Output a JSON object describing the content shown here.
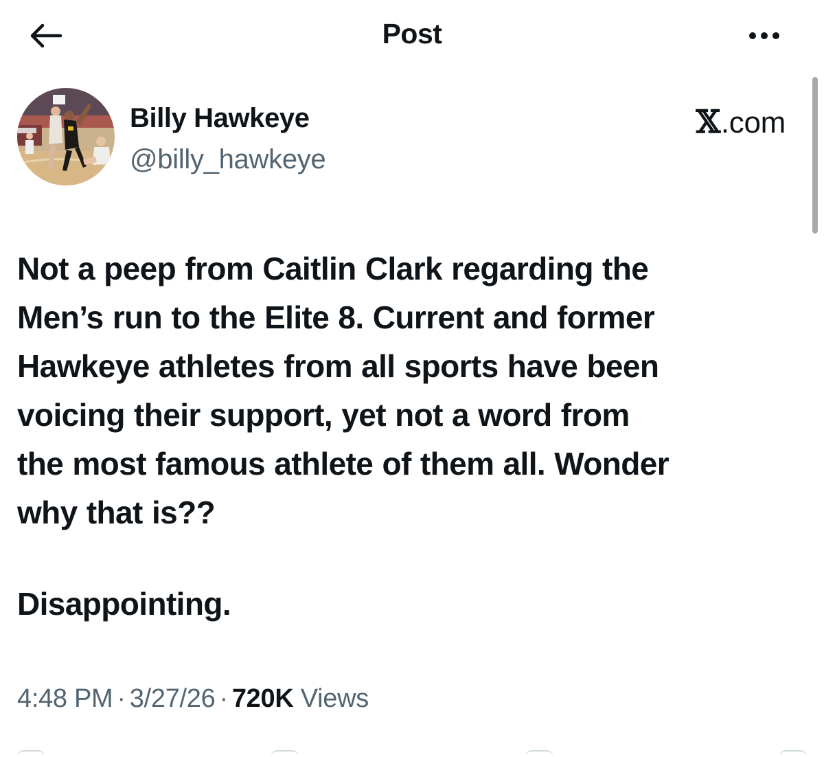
{
  "header": {
    "title": "Post",
    "back_icon": "arrow-left-icon",
    "more_icon": "more-horizontal-icon"
  },
  "author": {
    "name": "Billy Hawkeye",
    "handle": "@billy_hawkeye",
    "avatar_icon": "basketball-photo-avatar"
  },
  "source": {
    "brand": "𝕏",
    "domain": ".com"
  },
  "post": {
    "paragraph1": "Not a peep from Caitlin Clark regarding the\nMen’s run to the Elite 8. Current and former\nHawkeye athletes from all sports have been\nvoicing their support, yet not a word from\nthe most famous athlete of them all. Wonder\nwhy that is??",
    "paragraph2": "Disappointing."
  },
  "meta": {
    "time": "4:48 PM",
    "separator": "·",
    "date": "3/27/26",
    "views_count": "720K",
    "views_label": "Views"
  },
  "colors": {
    "text": "#0f1419",
    "secondary": "#536471",
    "scrollbar": "#a9a9ad"
  }
}
